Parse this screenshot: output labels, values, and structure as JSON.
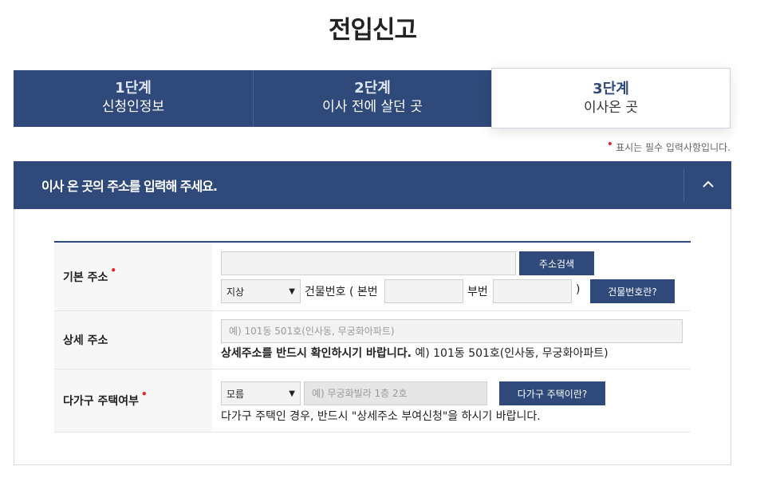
{
  "page": {
    "title": "전입신고"
  },
  "steps": [
    {
      "num": "1단계",
      "label": "신청인정보"
    },
    {
      "num": "2단계",
      "label": "이사 전에 살던 곳"
    },
    {
      "num": "3단계",
      "label": "이사온 곳"
    }
  ],
  "required_note": {
    "dot": "•",
    "text": "표시는 필수 입력사항입니다."
  },
  "panel": {
    "title": "이사 온 곳의 주소를 입력해 주세요."
  },
  "basic_address": {
    "label": "기본 주소",
    "star": "•",
    "address_value": "",
    "search_button": "주소검색",
    "land_type_selected": "지상",
    "building_number_label": "건물번호 ( 본번",
    "main_number_value": "",
    "sub_number_label": "부번",
    "sub_number_value": "",
    "close_paren": ")",
    "building_number_help_button": "건물번호란?"
  },
  "detail_address": {
    "label": "상세 주소",
    "placeholder": "예) 101동 501호(인사동, 무궁화아파트)",
    "notice_bold": "상세주소를 반드시 확인하시기 바랍니다.",
    "notice_example": "예) 101동 501호(인사동, 무궁화아파트)"
  },
  "multi_family": {
    "label": "다가구 주택여부",
    "star": "•",
    "selected": "모름",
    "placeholder": "예) 무궁화빌라 1층 2호",
    "help_button": "다가구 주택이란?",
    "notice": "다가구 주택인 경우, 반드시 \"상세주소 부여신청\"을 하시기 바랍니다."
  },
  "colors": {
    "primary": "#2f4a7a",
    "required": "#e0242b"
  }
}
